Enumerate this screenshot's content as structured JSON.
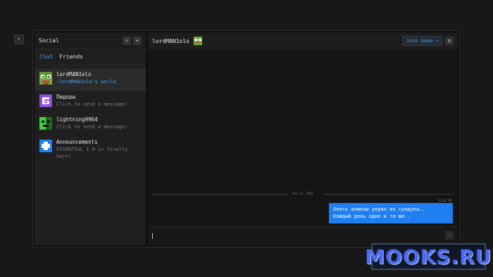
{
  "sidebar": {
    "title": "Social",
    "tabs": [
      {
        "label": "Chat",
        "active": true
      },
      {
        "label": "Friends",
        "active": false
      }
    ],
    "conversations": [
      {
        "name": "lordMAN1olo",
        "subtitle": "›lordMAN1olo's world",
        "active": true,
        "avatar": "frog-avatar"
      },
      {
        "name": "Пидоры",
        "subtitle": "Click to send a message!",
        "active": false,
        "avatar": "group-avatar"
      },
      {
        "name": "lightning9964",
        "subtitle": "Click to send a message!",
        "active": false,
        "avatar": "green-avatar"
      },
      {
        "name": "Announcements",
        "subtitle": "ESSENTIAL 1.0 is finally here!",
        "active": false,
        "avatar": "essential-avatar"
      }
    ]
  },
  "chat": {
    "title": "lordMAN1olo",
    "join_label": "Join Game ↗",
    "date_divider": "Aug 13, 2022",
    "message_time": "10:01 PM",
    "message_lines": [
      "Опять алмазы украл из сундука..",
      "Каждый день одно и то-же.."
    ]
  },
  "watermark": "MOOKS.RU",
  "colors": {
    "accent": "#3d9df0",
    "bubble": "#1f7ef0",
    "background": "#0f0f0f"
  }
}
